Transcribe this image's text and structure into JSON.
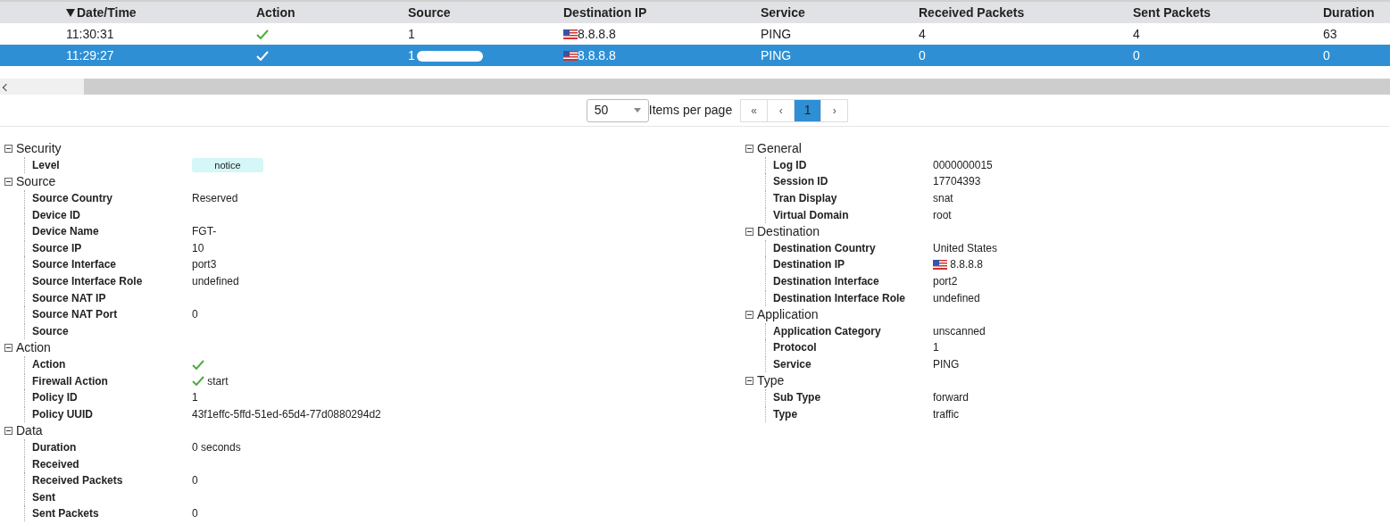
{
  "table": {
    "columns": [
      {
        "label": "Date/Time",
        "sorted": true
      },
      {
        "label": "Action",
        "sorted": false
      },
      {
        "label": "Source",
        "sorted": false
      },
      {
        "label": "Destination IP",
        "sorted": false
      },
      {
        "label": "Service",
        "sorted": false
      },
      {
        "label": "Received Packets",
        "sorted": false
      },
      {
        "label": "Sent Packets",
        "sorted": false
      },
      {
        "label": "Duration",
        "sorted": false
      }
    ],
    "rows": [
      {
        "selected": false,
        "cells": [
          {
            "kind": "text",
            "text": "11:30:31"
          },
          {
            "kind": "check"
          },
          {
            "kind": "text",
            "text": "1"
          },
          {
            "kind": "flag",
            "text": "8.8.8.8"
          },
          {
            "kind": "text",
            "text": "PING"
          },
          {
            "kind": "text",
            "text": "4"
          },
          {
            "kind": "text",
            "text": "4"
          },
          {
            "kind": "text",
            "text": "63"
          }
        ]
      },
      {
        "selected": true,
        "cells": [
          {
            "kind": "text",
            "text": "11:29:27"
          },
          {
            "kind": "check"
          },
          {
            "kind": "redacted",
            "text": "1"
          },
          {
            "kind": "flag",
            "text": "8.8.8.8"
          },
          {
            "kind": "text",
            "text": "PING"
          },
          {
            "kind": "text",
            "text": "0"
          },
          {
            "kind": "text",
            "text": "0"
          },
          {
            "kind": "text",
            "text": "0"
          }
        ]
      }
    ]
  },
  "pagination": {
    "page_size": "50",
    "page_size_label": "Items per page",
    "buttons": [
      {
        "label": "«",
        "selected": false
      },
      {
        "label": "‹",
        "selected": false
      },
      {
        "label": "1",
        "selected": true
      },
      {
        "label": "›",
        "selected": false
      }
    ]
  },
  "details_left": [
    {
      "title": "Security",
      "expanded": true,
      "children": [
        {
          "label": "Level",
          "value": "notice",
          "kind": "badge"
        }
      ]
    },
    {
      "title": "Source",
      "expanded": true,
      "children": [
        {
          "label": "Source Country",
          "value": "Reserved"
        },
        {
          "label": "Device ID"
        },
        {
          "label": "Device Name",
          "value": "FGT-"
        },
        {
          "label": "Source IP",
          "value": "10"
        },
        {
          "label": "Source Interface",
          "value": "port3"
        },
        {
          "label": "Source Interface Role",
          "value": "undefined"
        },
        {
          "label": "Source NAT IP"
        },
        {
          "label": "Source NAT Port",
          "value": "0"
        },
        {
          "label": "Source"
        }
      ]
    },
    {
      "title": "Action",
      "expanded": true,
      "children": [
        {
          "label": "Action",
          "kind": "check"
        },
        {
          "label": "Firewall Action",
          "value": "start",
          "kind": "check"
        },
        {
          "label": "Policy ID",
          "value": "1"
        },
        {
          "label": "Policy UUID",
          "value": "43f1effc-5ffd-51ed-65d4-77d0880294d2"
        }
      ]
    },
    {
      "title": "Data",
      "expanded": true,
      "children": [
        {
          "label": "Duration",
          "value": "0 seconds"
        },
        {
          "label": "Received"
        },
        {
          "label": "Received Packets",
          "value": "0"
        },
        {
          "label": "Sent"
        },
        {
          "label": "Sent Packets",
          "value": "0"
        }
      ]
    }
  ],
  "details_right": [
    {
      "title": "General",
      "expanded": true,
      "children": [
        {
          "label": "Log ID",
          "value": "0000000015"
        },
        {
          "label": "Session ID",
          "value": "17704393"
        },
        {
          "label": "Tran Display",
          "value": "snat"
        },
        {
          "label": "Virtual Domain",
          "value": "root"
        }
      ]
    },
    {
      "title": "Destination",
      "expanded": true,
      "children": [
        {
          "label": "Destination Country",
          "value": "United States"
        },
        {
          "label": "Destination IP",
          "value": "8.8.8.8",
          "kind": "flag"
        },
        {
          "label": "Destination Interface",
          "value": "port2"
        },
        {
          "label": "Destination Interface Role",
          "value": "undefined"
        }
      ]
    },
    {
      "title": "Application",
      "expanded": true,
      "children": [
        {
          "label": "Application Category",
          "value": "unscanned"
        },
        {
          "label": "Protocol",
          "value": "1"
        },
        {
          "label": "Service",
          "value": "PING"
        }
      ]
    },
    {
      "title": "Type",
      "expanded": true,
      "children": [
        {
          "label": "Sub Type",
          "value": "forward"
        },
        {
          "label": "Type",
          "value": "traffic"
        }
      ]
    }
  ]
}
